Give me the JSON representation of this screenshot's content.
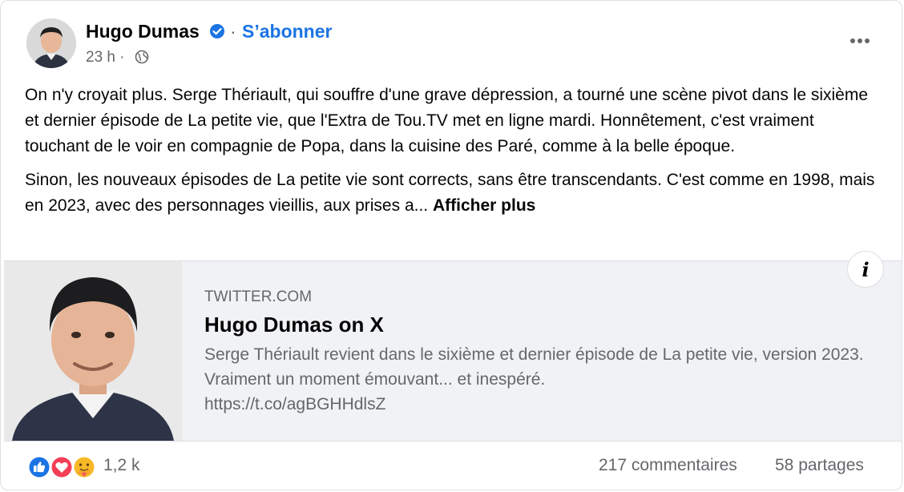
{
  "post": {
    "author": "Hugo Dumas",
    "separator": "·",
    "subscribe_label": "S’abonner",
    "time": "23 h ·",
    "paragraphs": [
      "On n'y croyait plus. Serge Thériault, qui souffre d'une grave dépression, a tourné une scène pivot dans le sixième et dernier épisode de La petite vie, que l'Extra de Tou.TV met en ligne mardi. Honnêtement, c'est vraiment touchant de le voir en compagnie de Popa, dans la cuisine des Paré, comme à la belle époque.",
      "Sinon, les nouveaux épisodes de La petite vie sont corrects, sans être transcendants. C'est comme en 1998, mais en 2023, avec des personnages vieillis, aux prises a..."
    ],
    "see_more_label": "Afficher plus"
  },
  "link": {
    "domain": "TWITTER.COM",
    "title": "Hugo Dumas on X",
    "description": "Serge Thériault revient dans le sixième et dernier épisode de La petite vie, version 2023. Vraiment un moment émouvant... et inespéré.",
    "url": "https://t.co/agBGHHdlsZ",
    "info_label": "i"
  },
  "stats": {
    "reactions_count": "1,2 k",
    "comments": "217 commentaires",
    "shares": "58 partages"
  },
  "icons": {
    "verified": "verified-badge-icon",
    "audience": "globe-icon",
    "more": "more-options-icon",
    "reactions": [
      "like-reaction-icon",
      "love-reaction-icon",
      "care-reaction-icon"
    ]
  },
  "colors": {
    "accent": "#1b74e4",
    "secondary_text": "#65676b",
    "link_card_bg": "#f0f2f5"
  }
}
